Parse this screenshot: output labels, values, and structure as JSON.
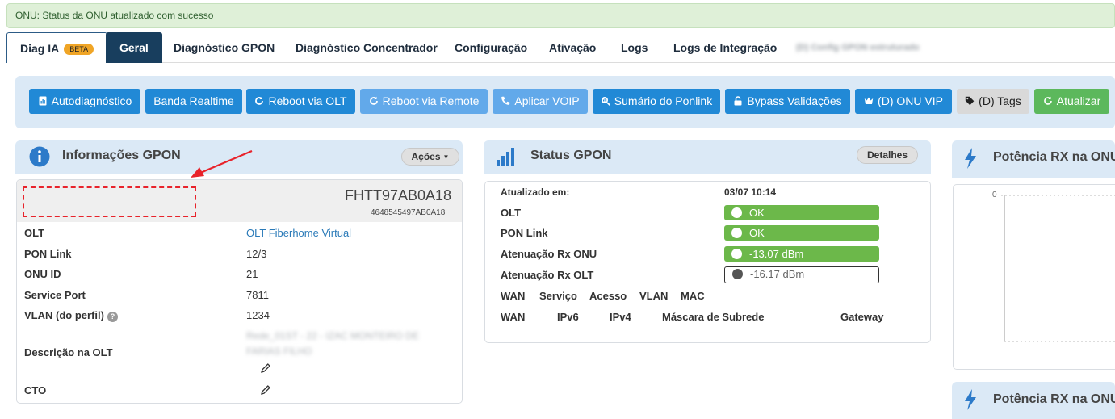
{
  "alert": {
    "message": "ONU: Status da ONU atualizado com sucesso"
  },
  "tabs": [
    {
      "label": "Diag IA",
      "badge": "BETA"
    },
    {
      "label": "Geral"
    },
    {
      "label": "Diagnóstico GPON"
    },
    {
      "label": "Diagnóstico Concentrador"
    },
    {
      "label": "Configuração"
    },
    {
      "label": "Ativação"
    },
    {
      "label": "Logs"
    },
    {
      "label": "Logs de Integração"
    },
    {
      "label": "(D) Config GPON estruturado"
    }
  ],
  "toolbar": {
    "autodiagnostico": "Autodiagnóstico",
    "banda_realtime": "Banda Realtime",
    "reboot_olt": "Reboot via OLT",
    "reboot_remote": "Reboot via Remote",
    "aplicar_voip": "Aplicar VOIP",
    "sumario_ponlink": "Sumário do Ponlink",
    "bypass": "Bypass Validações",
    "onu_vip": "(D) ONU VIP",
    "tags": "(D) Tags",
    "atualizar": "Atualizar"
  },
  "info_gpon": {
    "title": "Informações GPON",
    "actions_label": "Ações",
    "serial": "FHTT97AB0A18",
    "serial_hex": "4648545497AB0A18",
    "rows": [
      {
        "label": "OLT",
        "value": "OLT Fiberhome Virtual"
      },
      {
        "label": "PON Link",
        "value": "12/3"
      },
      {
        "label": "ONU ID",
        "value": "21"
      },
      {
        "label": "Service Port",
        "value": "7811"
      },
      {
        "label": "VLAN (do perfil)",
        "value": "1234"
      },
      {
        "label": "Descrição na OLT",
        "value": "Rede_01ST - 22 - IZAC MONTEIRO DE FARIAS FILHO"
      },
      {
        "label": "CTO",
        "value": ""
      }
    ]
  },
  "status_gpon": {
    "title": "Status GPON",
    "details_label": "Detalhes",
    "updated_label": "Atualizado em:",
    "updated_value": "03/07 10:14",
    "olt_label": "OLT",
    "olt_value": "OK",
    "ponlink_label": "PON Link",
    "ponlink_value": "OK",
    "rx_onu_label": "Atenuação Rx ONU",
    "rx_onu_value": "-13.07 dBm",
    "rx_olt_label": "Atenuação Rx OLT",
    "rx_olt_value": "-16.17 dBm",
    "wan_headers": [
      "WAN",
      "Serviço",
      "Acesso",
      "VLAN",
      "MAC"
    ],
    "ip_headers": [
      "WAN",
      "IPv6",
      "IPv4",
      "Máscara de Subrede",
      "Gateway"
    ]
  },
  "potencia": {
    "title1": "Potência RX na ONU",
    "title2": "Potência RX na ONU",
    "y_tick": "0"
  },
  "colors": {
    "primary": "#2189d6",
    "primary_light": "#62a9ea",
    "success": "#5cb85c",
    "panel_bg": "#dbe9f6",
    "active_tab": "#183e5e",
    "annotation": "#e8232b"
  }
}
